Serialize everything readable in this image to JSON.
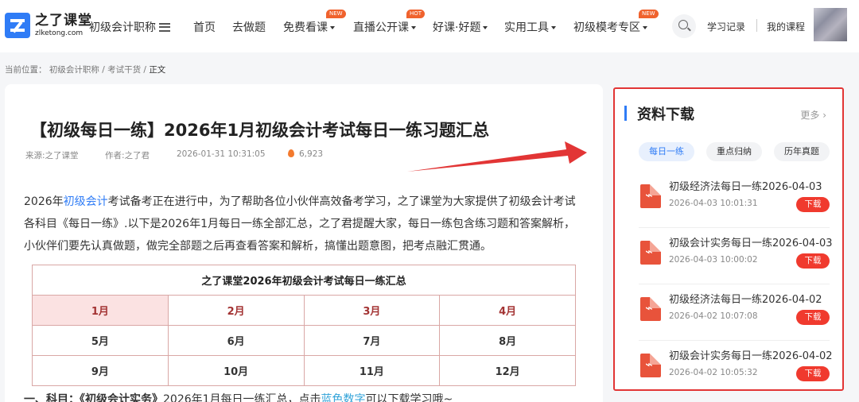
{
  "header": {
    "logo_cn": "之了课堂",
    "logo_en": "zlketong.com",
    "category": "初级会计职称",
    "nav": [
      {
        "label": "首页",
        "caret": false
      },
      {
        "label": "去做题",
        "caret": false
      },
      {
        "label": "免费看课",
        "caret": true,
        "tag": "NEW"
      },
      {
        "label": "直播公开课",
        "caret": true,
        "tag": "HOT"
      },
      {
        "label": "好课·好题",
        "caret": true
      },
      {
        "label": "实用工具",
        "caret": true
      },
      {
        "label": "初级模考专区",
        "caret": true,
        "tag": "NEW"
      }
    ],
    "study_record": "学习记录",
    "my_courses": "我的课程",
    "search_icon": "search-icon"
  },
  "breadcrumb": {
    "prefix": "当前位置：",
    "items": [
      "初级会计职称",
      "考试干货",
      "正文"
    ],
    "sep": "/"
  },
  "article": {
    "title": "【初级每日一练】2026年1月初级会计考试每日一练习题汇总",
    "source": "来源:之了课堂",
    "author": "作者:之了君",
    "datetime": "2026-01-31 10:31:05",
    "views": "6,923",
    "para_pre": "2026年",
    "para_link": "初级会计",
    "para_post": "考试备考正在进行中，为了帮助各位小伙伴高效备考学习，之了课堂为大家提供了初级会计考试各科目《每日一练》.以下是2026年1月每日一练全部汇总，之了君提醒大家，每日一练包含练习题和答案解析，小伙伴们要先认真做题，做完全部题之后再查看答案和解析，搞懂出题意图，把考点融汇贯通。",
    "table": {
      "heading": "之了课堂2026年初级会计考试每日一练汇总",
      "rows": [
        [
          "1月",
          "2月",
          "3月",
          "4月"
        ],
        [
          "5月",
          "6月",
          "7月",
          "8月"
        ],
        [
          "9月",
          "10月",
          "11月",
          "12月"
        ]
      ]
    },
    "bottom_line": {
      "prefix": "一、科目：",
      "subject": "《初级会计实务》",
      "mid": "2026年1月每日一练汇总，点击",
      "link": "蓝色数字",
      "suffix": "可以下载学习哦~"
    }
  },
  "sidebar": {
    "title": "资料下载",
    "more": "更多 ›",
    "tabs": [
      "每日一练",
      "重点归纳",
      "历年真题"
    ],
    "active_tab": 0,
    "download_label": "下载",
    "items": [
      {
        "title": "初级经济法每日一练2026-04-03",
        "date": "2026-04-03 10:01:31"
      },
      {
        "title": "初级会计实务每日一练2026-04-03",
        "date": "2026-04-03 10:00:02"
      },
      {
        "title": "初级经济法每日一练2026-04-02",
        "date": "2026-04-02 10:07:08"
      },
      {
        "title": "初级会计实务每日一练2026-04-02",
        "date": "2026-04-02 10:05:32"
      }
    ]
  },
  "colors": {
    "brand_blue": "#2f7cf6",
    "highlight_red": "#e23535",
    "download_red": "#f03a2e",
    "table_border": "#d9a7a5"
  }
}
